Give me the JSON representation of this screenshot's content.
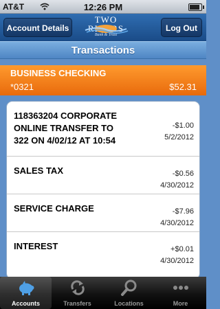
{
  "status_bar": {
    "carrier": "AT&T",
    "time": "12:26 PM"
  },
  "header": {
    "left_button": "Account Details",
    "right_button": "Log Out",
    "logo_line1": "TWO",
    "logo_line2": "RIVERS",
    "logo_line3": "Bank & Trust"
  },
  "section_title": "Transactions",
  "account": {
    "name": "BUSINESS CHECKING",
    "number": "*0321",
    "balance": "$52.31"
  },
  "transactions": [
    {
      "description": "118363204 CORPORATE ONLINE TRANSFER TO 322 ON 4/02/12 AT 10:54",
      "amount": "-$1.00",
      "date": "5/2/2012"
    },
    {
      "description": "SALES TAX",
      "amount": "-$0.56",
      "date": "4/30/2012"
    },
    {
      "description": "SERVICE CHARGE",
      "amount": "-$7.96",
      "date": "4/30/2012"
    },
    {
      "description": "INTEREST",
      "amount": "+$0.01",
      "date": "4/30/2012"
    }
  ],
  "tabs": [
    {
      "label": "Accounts",
      "icon": "piggy-bank-icon",
      "active": true
    },
    {
      "label": "Transfers",
      "icon": "transfer-arrows-icon",
      "active": false
    },
    {
      "label": "Locations",
      "icon": "magnifier-icon",
      "active": false
    },
    {
      "label": "More",
      "icon": "more-dots-icon",
      "active": false
    }
  ],
  "colors": {
    "accent_orange": "#f58220",
    "header_blue": "#1f5a9e",
    "section_blue": "#5f97d3"
  }
}
